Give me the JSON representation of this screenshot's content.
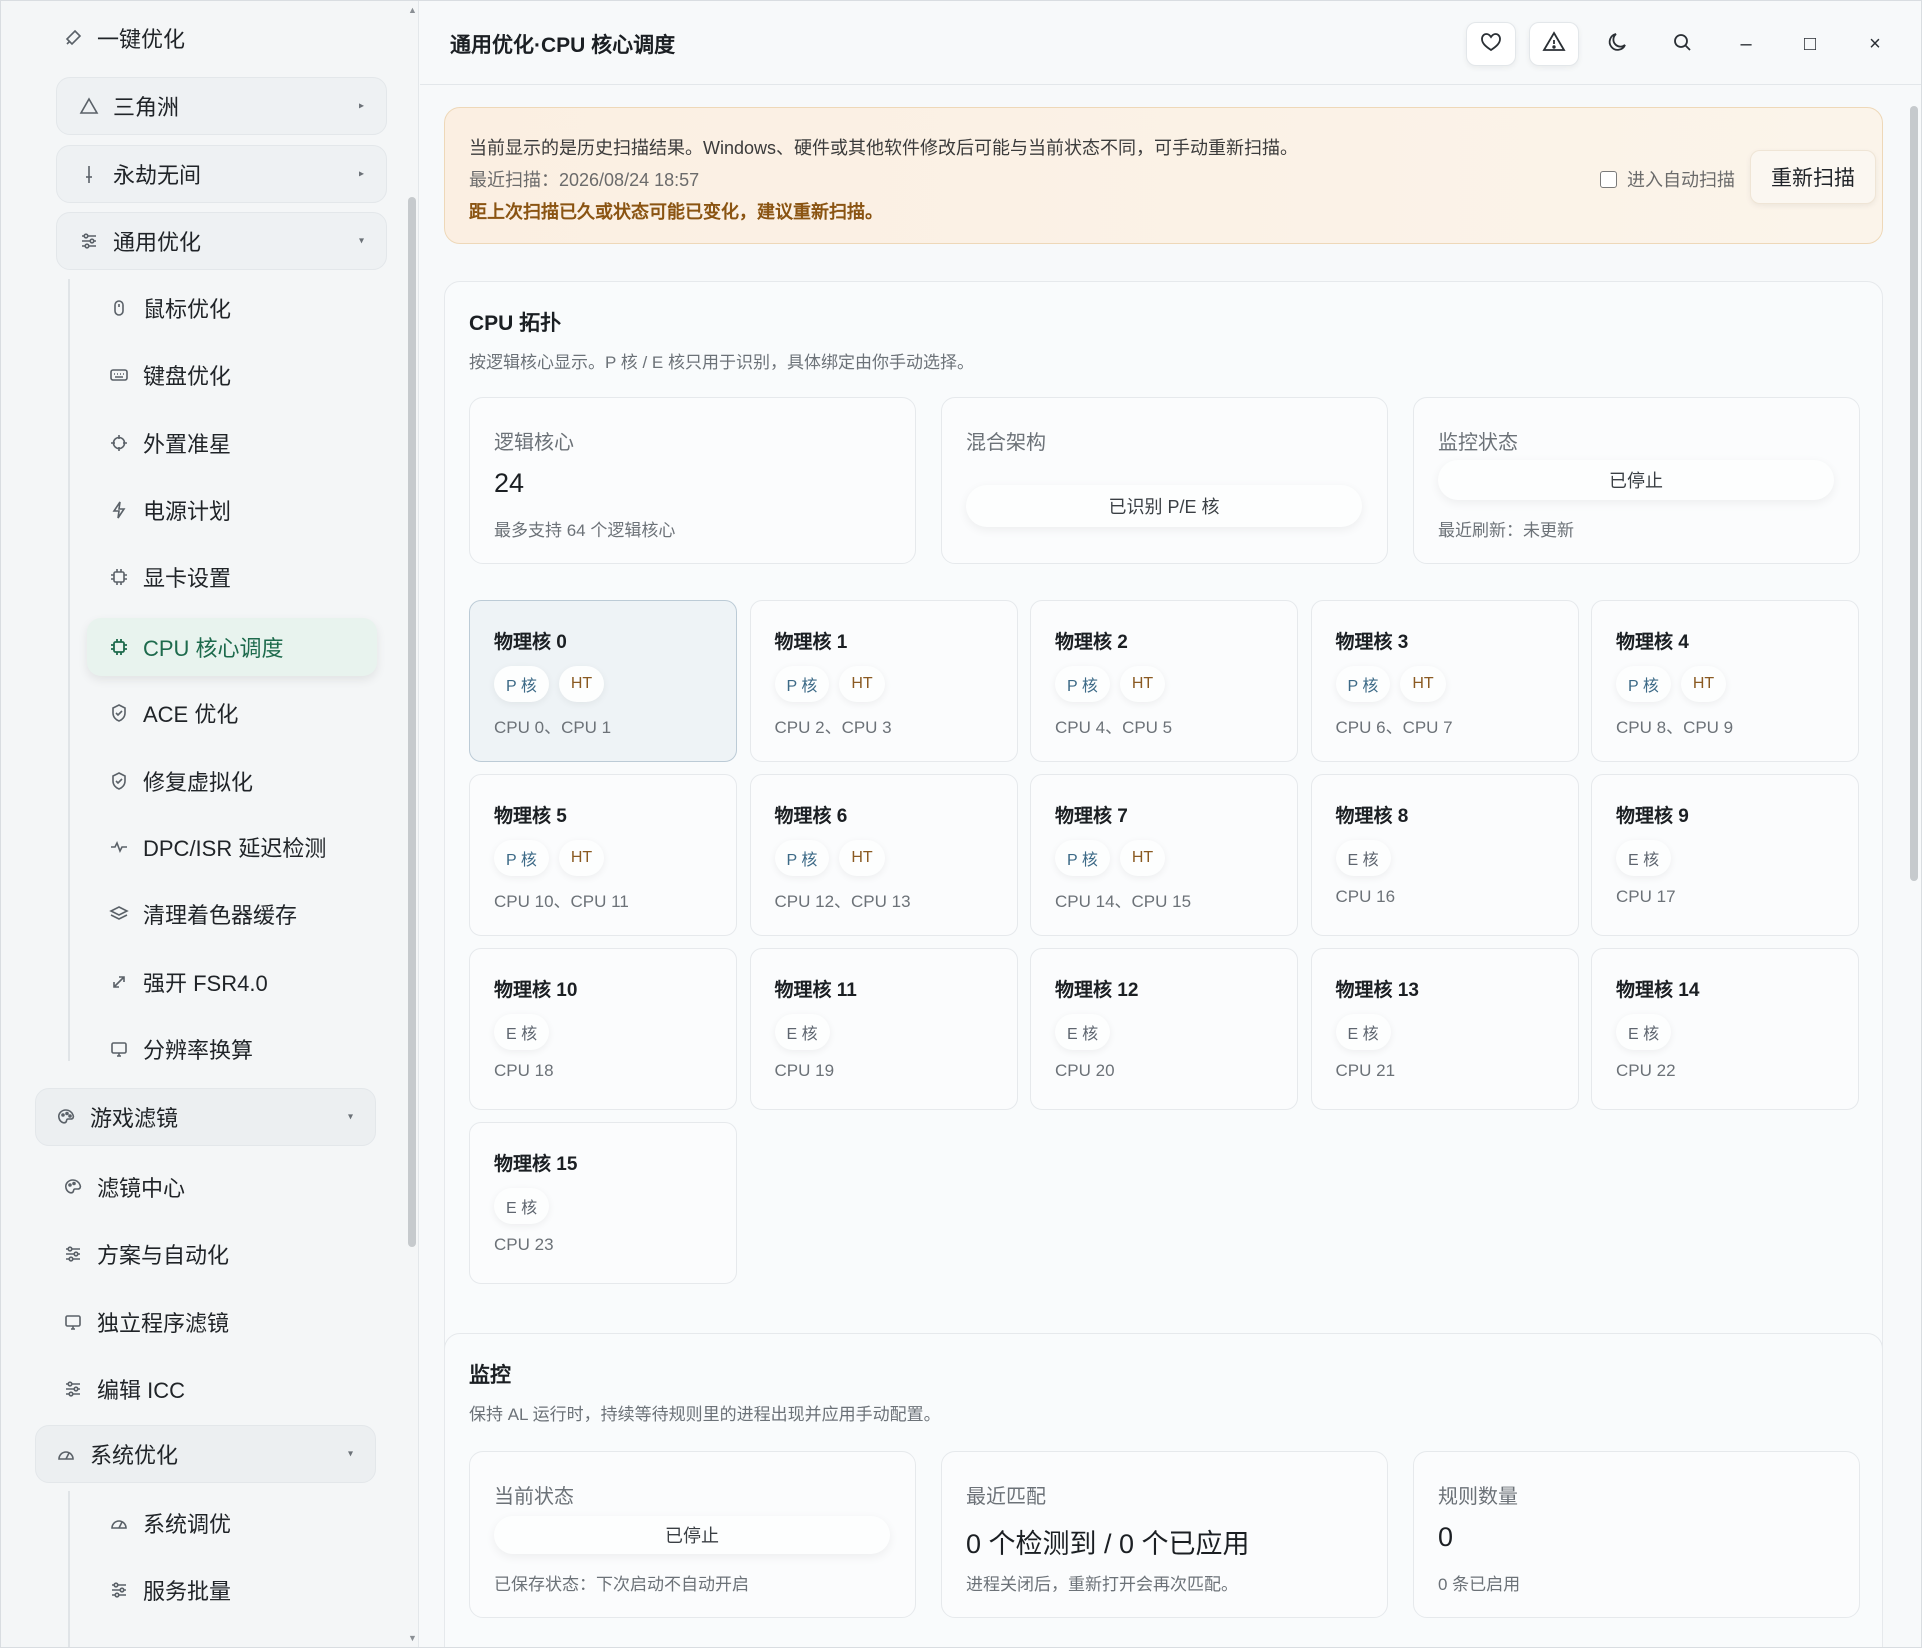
{
  "sidebar": {
    "top_item": "一键优化",
    "groups": [
      {
        "label": "三角洲",
        "caret": "▸"
      },
      {
        "label": "永劫无间",
        "caret": "▸"
      },
      {
        "label": "通用优化",
        "caret": "▾"
      }
    ],
    "general_items": [
      "鼠标优化",
      "键盘优化",
      "外置准星",
      "电源计划",
      "显卡设置",
      "CPU 核心调度",
      "ACE 优化",
      "修复虚拟化",
      "DPC/ISR 延迟检测",
      "清理着色器缓存",
      "强开 FSR4.0",
      "分辨率换算"
    ],
    "filter_group": {
      "label": "游戏滤镜",
      "caret": "▾"
    },
    "filter_items": [
      "滤镜中心",
      "方案与自动化",
      "独立程序滤镜",
      "编辑 ICC"
    ],
    "system_group": {
      "label": "系统优化",
      "caret": "▾"
    },
    "system_items": [
      "系统调优",
      "服务批量"
    ]
  },
  "header": {
    "title": "通用优化·CPU 核心调度",
    "minimize": "–",
    "maximize": "□",
    "close": "×"
  },
  "notice": {
    "line1": "当前显示的是历史扫描结果。Windows、硬件或其他软件修改后可能与当前状态不同，可手动重新扫描。",
    "line2": "最近扫描：2026/08/24 18:57",
    "line3": "距上次扫描已久或状态可能已变化，建议重新扫描。",
    "auto_scan_label": "进入自动扫描",
    "auto_scan_checked": false,
    "rescan_button": "重新扫描"
  },
  "topology": {
    "title": "CPU 拓扑",
    "desc": "按逻辑核心显示。P 核 / E 核只用于识别，具体绑定由你手动选择。",
    "logical": {
      "label": "逻辑核心",
      "value": "24",
      "sub": "最多支持 64 个逻辑核心"
    },
    "hybrid": {
      "label": "混合架构",
      "pill": "已识别 P/E 核"
    },
    "monitor": {
      "label": "监控状态",
      "pill": "已停止",
      "sub": "最近刷新：未更新"
    },
    "cores": [
      {
        "name": "物理核 0",
        "tags": [
          "P 核",
          "HT"
        ],
        "cpus": "CPU 0、CPU 1",
        "selected": true
      },
      {
        "name": "物理核 1",
        "tags": [
          "P 核",
          "HT"
        ],
        "cpus": "CPU 2、CPU 3"
      },
      {
        "name": "物理核 2",
        "tags": [
          "P 核",
          "HT"
        ],
        "cpus": "CPU 4、CPU 5"
      },
      {
        "name": "物理核 3",
        "tags": [
          "P 核",
          "HT"
        ],
        "cpus": "CPU 6、CPU 7"
      },
      {
        "name": "物理核 4",
        "tags": [
          "P 核",
          "HT"
        ],
        "cpus": "CPU 8、CPU 9"
      },
      {
        "name": "物理核 5",
        "tags": [
          "P 核",
          "HT"
        ],
        "cpus": "CPU 10、CPU 11"
      },
      {
        "name": "物理核 6",
        "tags": [
          "P 核",
          "HT"
        ],
        "cpus": "CPU 12、CPU 13"
      },
      {
        "name": "物理核 7",
        "tags": [
          "P 核",
          "HT"
        ],
        "cpus": "CPU 14、CPU 15"
      },
      {
        "name": "物理核 8",
        "tags": [
          "E 核"
        ],
        "cpus": "CPU 16"
      },
      {
        "name": "物理核 9",
        "tags": [
          "E 核"
        ],
        "cpus": "CPU 17"
      },
      {
        "name": "物理核 10",
        "tags": [
          "E 核"
        ],
        "cpus": "CPU 18"
      },
      {
        "name": "物理核 11",
        "tags": [
          "E 核"
        ],
        "cpus": "CPU 19"
      },
      {
        "name": "物理核 12",
        "tags": [
          "E 核"
        ],
        "cpus": "CPU 20"
      },
      {
        "name": "物理核 13",
        "tags": [
          "E 核"
        ],
        "cpus": "CPU 21"
      },
      {
        "name": "物理核 14",
        "tags": [
          "E 核"
        ],
        "cpus": "CPU 22"
      },
      {
        "name": "物理核 15",
        "tags": [
          "E 核"
        ],
        "cpus": "CPU 23"
      }
    ]
  },
  "monitor": {
    "title": "监控",
    "desc": "保持 AL 运行时，持续等待规则里的进程出现并应用手动配置。",
    "current": {
      "label": "当前状态",
      "pill": "已停止",
      "sub": "已保存状态：下次启动不自动开启"
    },
    "recent": {
      "label": "最近匹配",
      "value": "0 个检测到 / 0 个已应用",
      "sub": "进程关闭后，重新打开会再次匹配。"
    },
    "rules": {
      "label": "规则数量",
      "value": "0",
      "sub": "0 条已启用"
    }
  },
  "colors": {
    "accent": "#1d6a4c",
    "warning_text": "#8a5412",
    "p_core": "#3d6a87",
    "ht": "#8a5a22"
  },
  "icons": {
    "header": [
      "heart-icon",
      "warning-icon",
      "moon-icon",
      "search-icon"
    ],
    "cpu": "chip-icon"
  }
}
